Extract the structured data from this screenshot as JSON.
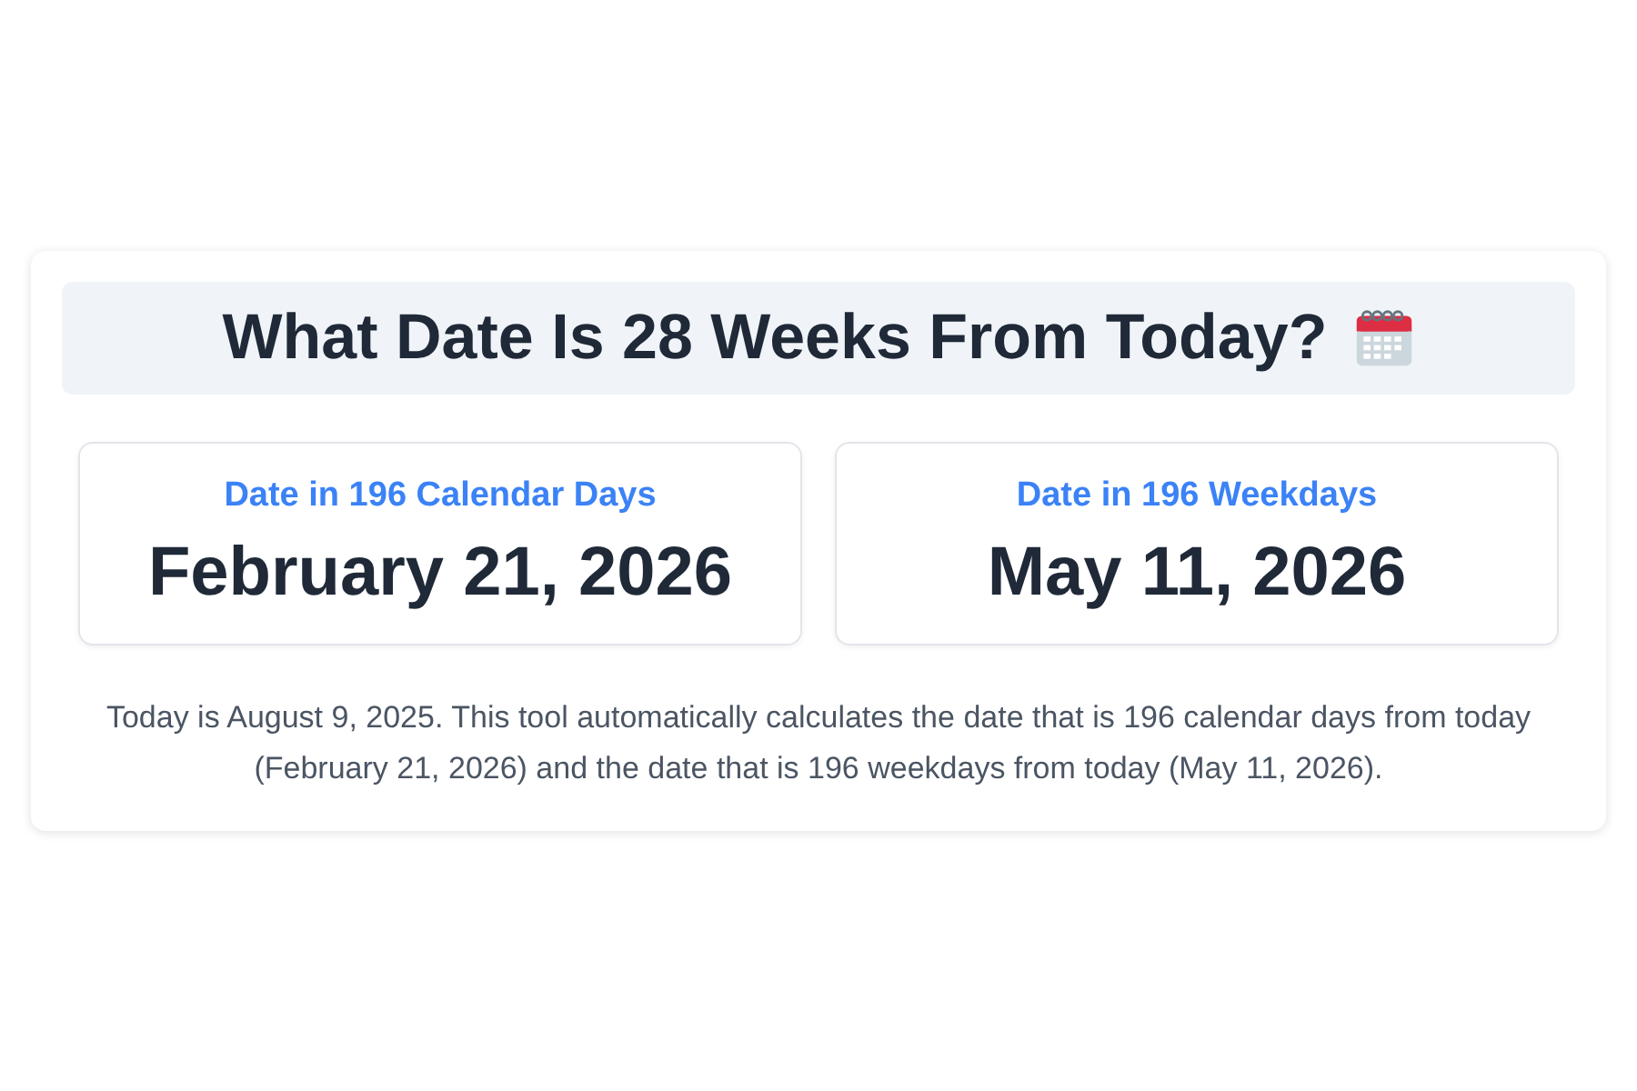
{
  "title": "What Date Is 28 Weeks From Today?",
  "results": [
    {
      "label": "Date in 196 Calendar Days",
      "date": "February 21, 2026"
    },
    {
      "label": "Date in 196 Weekdays",
      "date": "May 11, 2026"
    }
  ],
  "description": "Today is August 9, 2025. This tool automatically calculates the date that is 196 calendar days from today (February 21, 2026) and the date that is 196 weekdays from today (May 11, 2026)."
}
